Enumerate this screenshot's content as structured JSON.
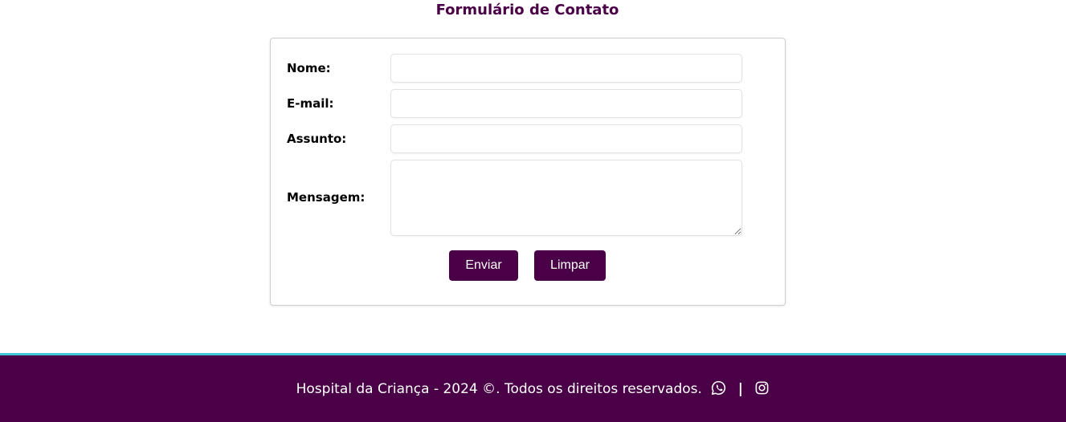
{
  "header": {
    "title": "Formulário de Contato"
  },
  "form": {
    "fields": [
      {
        "label": "Nome:",
        "value": "",
        "placeholder": ""
      },
      {
        "label": "E-mail:",
        "value": "",
        "placeholder": ""
      },
      {
        "label": "Assunto:",
        "value": "",
        "placeholder": ""
      },
      {
        "label": "Mensagem:",
        "value": "",
        "placeholder": ""
      }
    ],
    "submit_label": "Enviar",
    "reset_label": "Limpar"
  },
  "footer": {
    "text": "Hospital da Criança - 2024 ©. Todos os direitos reservados.",
    "separator": "|",
    "icons": [
      "whatsapp-icon",
      "instagram-icon"
    ]
  },
  "colors": {
    "brand": "#4a0046",
    "footer_accent": "#3fc6d8",
    "text": "#000000",
    "background": "#ffffff"
  }
}
